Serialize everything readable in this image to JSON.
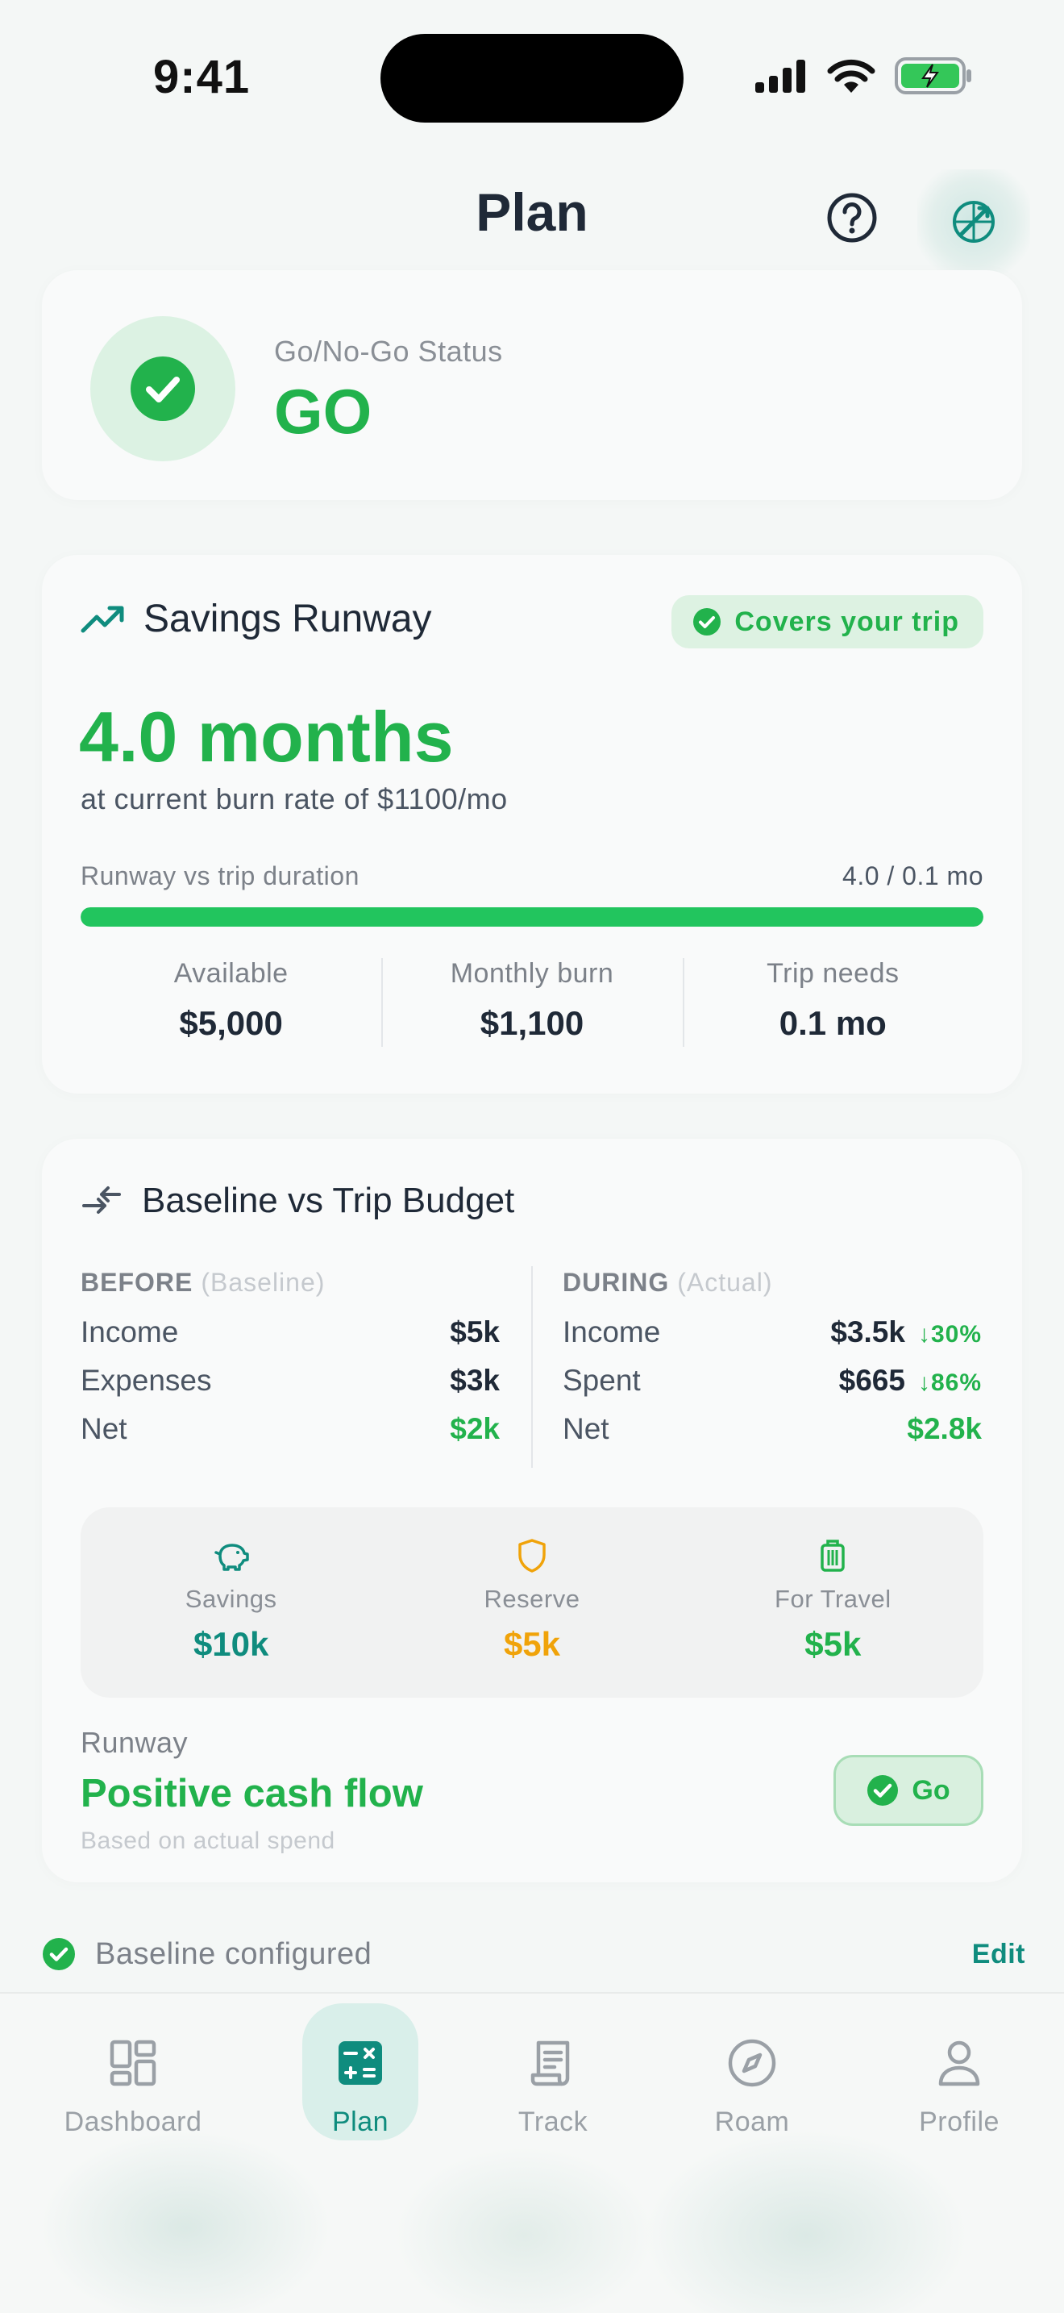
{
  "status_bar": {
    "time": "9:41"
  },
  "header": {
    "title": "Plan",
    "help_icon": "question-circle-icon",
    "compass_icon": "compass-route-icon"
  },
  "go_status": {
    "label": "Go/No-Go Status",
    "value": "GO",
    "icon": "check-circle-icon"
  },
  "savings_runway": {
    "title": "Savings Runway",
    "icon": "trending-up-icon",
    "badge": "Covers your trip",
    "months": "4.0 months",
    "burn_text": "at current burn rate of $1100/mo",
    "progress_label": "Runway vs trip duration",
    "progress_value_text": "4.0 / 0.1 mo",
    "progress_fraction": 1.0,
    "stats": [
      {
        "label": "Available",
        "value": "$5,000"
      },
      {
        "label": "Monthly burn",
        "value": "$1,100"
      },
      {
        "label": "Trip needs",
        "value": "0.1 mo"
      }
    ]
  },
  "budget": {
    "title": "Baseline vs Trip Budget",
    "icon": "compare-arrows-icon",
    "before": {
      "heading": "BEFORE",
      "sub": "(Baseline)",
      "rows": [
        {
          "label": "Income",
          "value": "$5k"
        },
        {
          "label": "Expenses",
          "value": "$3k"
        },
        {
          "label": "Net",
          "value": "$2k"
        }
      ]
    },
    "during": {
      "heading": "DURING",
      "sub": "(Actual)",
      "rows": [
        {
          "label": "Income",
          "value": "$3.5k",
          "delta": "↓30%"
        },
        {
          "label": "Spent",
          "value": "$665",
          "delta": "↓86%"
        },
        {
          "label": "Net",
          "value": "$2.8k"
        }
      ]
    },
    "allocation": [
      {
        "label": "Savings",
        "value": "$10k",
        "color": "#0F8C7E",
        "icon": "piggy-bank-icon"
      },
      {
        "label": "Reserve",
        "value": "$5k",
        "color": "#F0A30A",
        "icon": "shield-icon"
      },
      {
        "label": "For Travel",
        "value": "$5k",
        "color": "#22B24C",
        "icon": "luggage-icon"
      }
    ],
    "runway_label": "Runway",
    "runway_value": "Positive cash flow",
    "runway_sub": "Based on actual spend",
    "go_button": "Go"
  },
  "baseline": {
    "text": "Baseline configured",
    "edit": "Edit"
  },
  "tabs": [
    {
      "label": "Dashboard",
      "icon": "dashboard-grid-icon",
      "active": false
    },
    {
      "label": "Plan",
      "icon": "calculator-icon",
      "active": true
    },
    {
      "label": "Track",
      "icon": "receipt-icon",
      "active": false
    },
    {
      "label": "Roam",
      "icon": "compass-icon",
      "active": false
    },
    {
      "label": "Profile",
      "icon": "person-icon",
      "active": false
    }
  ],
  "colors": {
    "green": "#22B24C",
    "teal": "#0F8C7E",
    "amber": "#F0A30A"
  }
}
